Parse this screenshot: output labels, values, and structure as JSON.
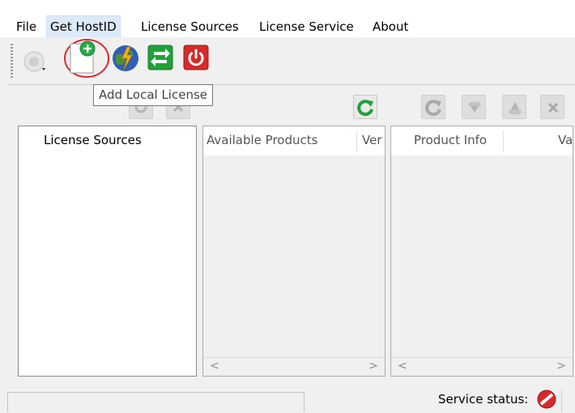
{
  "menu": {
    "file": "File",
    "get_hostid": "Get HostID",
    "license_sources": "License Sources",
    "license_service": "License Service",
    "about": "About"
  },
  "toolbar": {
    "tooltip": "Add Local License",
    "icons": [
      "server-dropdown-icon",
      "add-local-license-icon",
      "globe-lightning-icon",
      "transfer-arrows-icon",
      "power-icon"
    ]
  },
  "panels": {
    "sources_header": "License Sources",
    "products_headers": [
      "Available Products",
      "Ver"
    ],
    "info_headers": [
      "Product Info",
      "Va"
    ]
  },
  "status": {
    "label": "Service status:"
  },
  "colors": {
    "highlight_circle": "#e0282d",
    "refresh_green": "#21a038",
    "power_red": "#d42a2a"
  }
}
